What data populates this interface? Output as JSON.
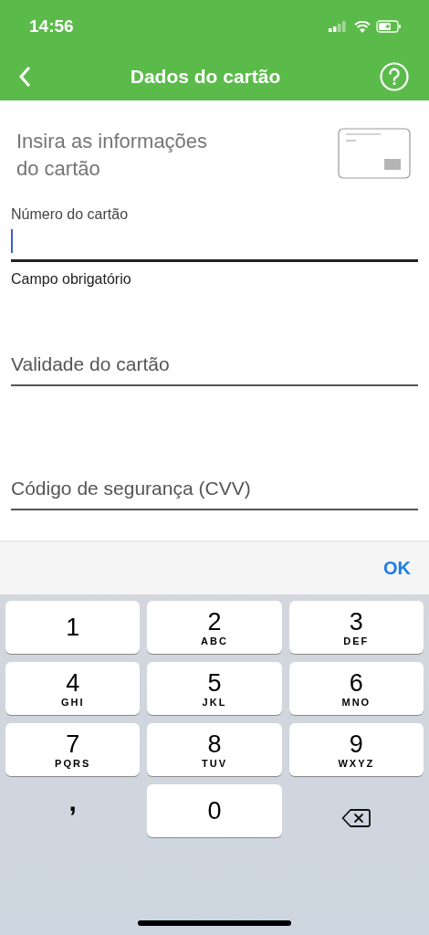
{
  "status_bar": {
    "time": "14:56"
  },
  "nav": {
    "title": "Dados do cartão"
  },
  "intro": "Insira as informações do cartão",
  "fields": [
    {
      "label": "Número do cartão",
      "focused": true,
      "helper": "Campo obrigatório"
    },
    {
      "label": "Validade do cartão",
      "focused": false
    },
    {
      "label": "Código de segurança (CVV)",
      "focused": false
    }
  ],
  "toolbar": {
    "done": "OK"
  },
  "keys": [
    {
      "kind": "digit",
      "digit": "1"
    },
    {
      "kind": "digit",
      "digit": "2",
      "letters": "ABC"
    },
    {
      "kind": "digit",
      "digit": "3",
      "letters": "DEF"
    },
    {
      "kind": "digit",
      "digit": "4",
      "letters": "GHI"
    },
    {
      "kind": "digit",
      "digit": "5",
      "letters": "JKL"
    },
    {
      "kind": "digit",
      "digit": "6",
      "letters": "MNO"
    },
    {
      "kind": "digit",
      "digit": "7",
      "letters": "PQRS"
    },
    {
      "kind": "digit",
      "digit": "8",
      "letters": "TUV"
    },
    {
      "kind": "digit",
      "digit": "9",
      "letters": "WXYZ"
    },
    {
      "kind": "symbol",
      "digit": ","
    },
    {
      "kind": "digit",
      "digit": "0"
    },
    {
      "kind": "delete"
    }
  ]
}
